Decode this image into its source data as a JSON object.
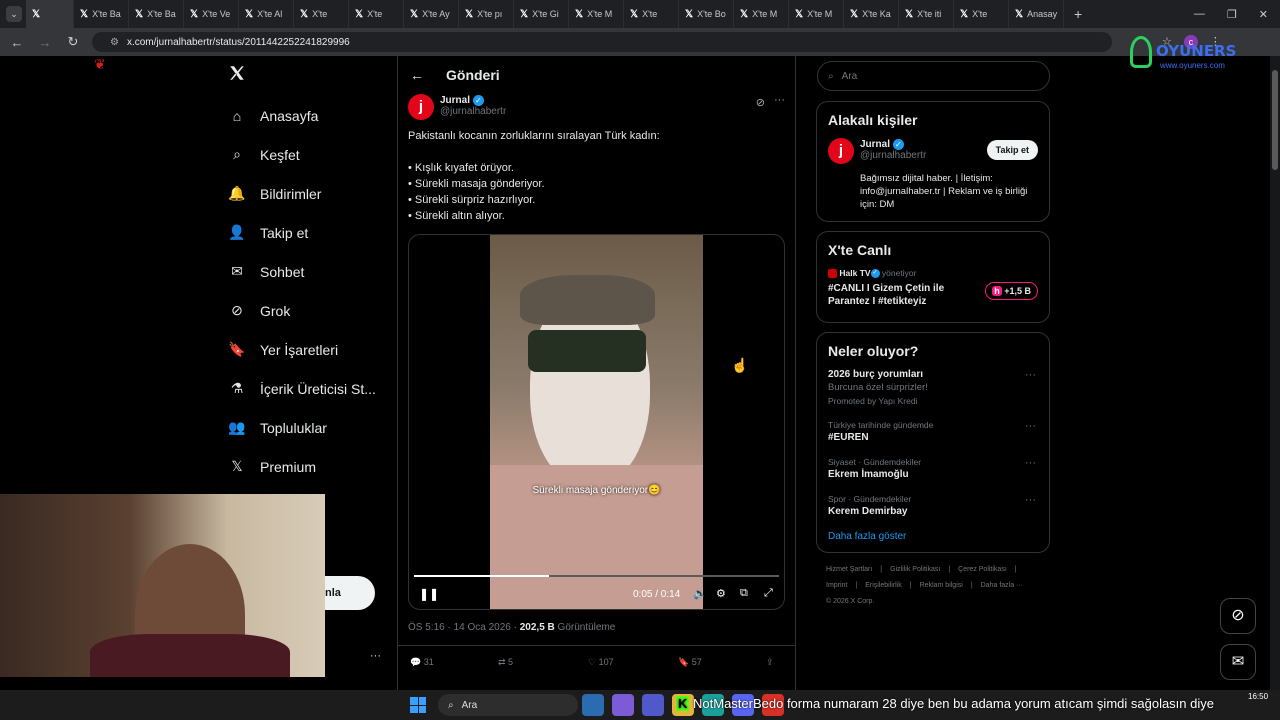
{
  "browser": {
    "tabs": [
      "X'te Ba",
      "X'te Ba",
      "X'te Ba",
      "X'te Ve",
      "X'te Al",
      "X'te",
      "X'te",
      "X'te Ay",
      "X'te pı",
      "X'te Gi",
      "X'te M",
      "X'te",
      "X'te Bo",
      "X'te M",
      "X'te M",
      "X'te Ka",
      "X'te iti",
      "X'te",
      "Anasay"
    ],
    "url": "x.com/jurnalhabertr/status/2011442252241829996",
    "new_tab": "+"
  },
  "overlay": {
    "watermark_line1": "OYUNERS",
    "watermark_line2": "www.oyuners.com"
  },
  "nav": {
    "items": [
      "Anasayfa",
      "Keşfet",
      "Bildirimler",
      "Takip et",
      "Sohbet",
      "Grok",
      "Yer İşaretleri",
      "İçerik Üreticisi St...",
      "Topluluklar",
      "Premium"
    ],
    "post_button_partial": "nla",
    "more": "···"
  },
  "post": {
    "header_title": "Gönderi",
    "author_name": "Jurnal",
    "author_handle": "@jurnalhabertr",
    "avatar_letter": "j",
    "text_intro": "Pakistanlı kocanın zorluklarını sıralayan Türk kadın:",
    "bullets": [
      "• Kışlık kıyafet örüyor.",
      "• Sürekli masaja gönderiyor.",
      "• Sürekli sürpriz hazırlıyor.",
      "• Sürekli altın alıyor."
    ],
    "video_caption": "Sürekli masaja gönderiyor😊",
    "video_time": "0:05 / 0:14",
    "video_progress": 0.37,
    "timestamp": "ÖS 5:16 · 14 Oca 2026 · ",
    "views_count": "202,5 B",
    "views_label": " Görüntüleme",
    "replies": "31",
    "reposts": "5",
    "likes": "107",
    "bookmarks": "57"
  },
  "right": {
    "search_placeholder": "Ara",
    "related_title": "Alakalı kişiler",
    "related_name": "Jurnal",
    "related_handle": "@jurnalhabertr",
    "follow_label": "Takip et",
    "related_bio": "Bağımsız dijital haber. | İletişim: info@jurnalhaber.tr | Reklam ve iş birliği için: DM",
    "live_title": "X'te Canlı",
    "live_host": "Halk TV",
    "live_host_suffix": " yönetiyor",
    "live_text": "#CANLI I Gizem Çetin ile Parantez I #tetikteyiz",
    "live_count": "+1,5 B",
    "trends_title": "Neler oluyor?",
    "trends": [
      {
        "context": "",
        "title": "2026 burç yorumları",
        "sub": "Burcuna özel sürprizler!",
        "promo": "Promoted by Yapı Kredi"
      },
      {
        "context": "Türkiye tarihinde gündemde",
        "title": "#EUREN",
        "sub": "",
        "promo": ""
      },
      {
        "context": "Siyaset · Gündemdekiler",
        "title": "Ekrem İmamoğlu",
        "sub": "",
        "promo": ""
      },
      {
        "context": "Spor · Gündemdekiler",
        "title": "Kerem Demirbay",
        "sub": "",
        "promo": ""
      }
    ],
    "show_more": "Daha fazla göster",
    "footer": [
      "Hizmet Şartları",
      "|",
      "Gizlilik Politikası",
      "|",
      "Çerez Politikası",
      "|",
      "Imprint",
      "|",
      "Erişilebilirlik",
      "|",
      "Reklam bilgisi",
      "|",
      "Daha fazla ···",
      "© 2026 X Corp."
    ]
  },
  "taskbar": {
    "search": "Ara",
    "ticker": "NotMasterBedo forma numaram 28 diye ben bu adama yorum atıcam şimdi sağolasın diye",
    "time": "16:50"
  }
}
